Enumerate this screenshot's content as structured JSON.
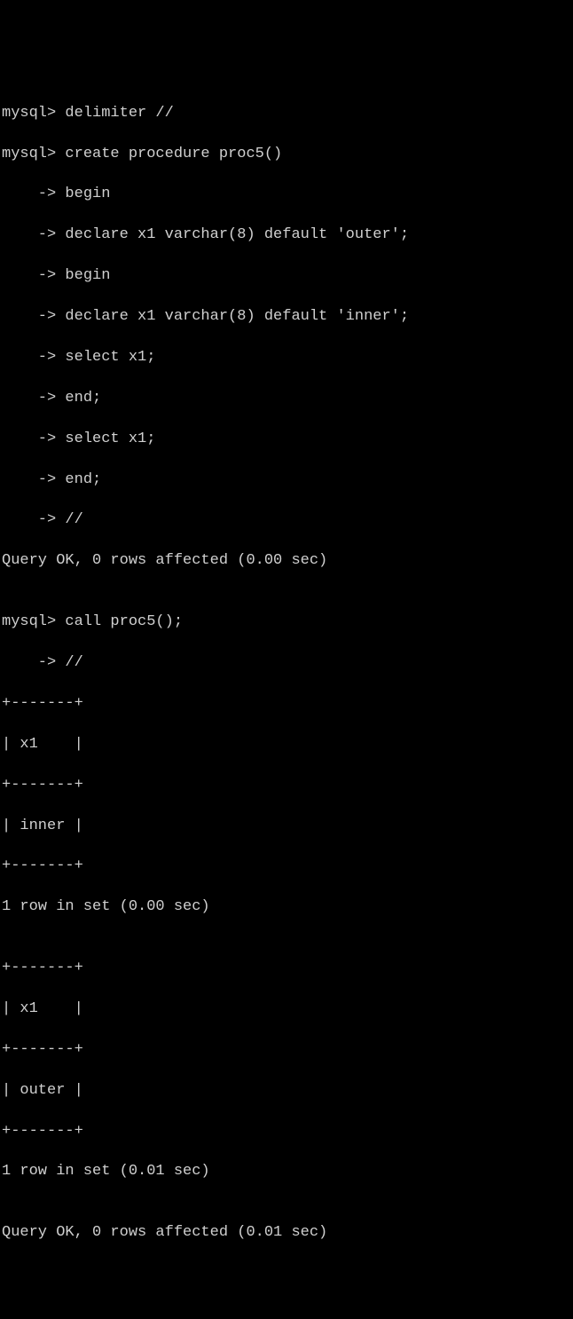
{
  "lines": [
    "mysql> delimiter //",
    "mysql> create procedure proc5()",
    "    -> begin",
    "    -> declare x1 varchar(8) default 'outer';",
    "    -> begin",
    "    -> declare x1 varchar(8) default 'inner';",
    "    -> select x1;",
    "    -> end;",
    "    -> select x1;",
    "    -> end;",
    "    -> //",
    "Query OK, 0 rows affected (0.00 sec)",
    "",
    "mysql> call proc5();",
    "    -> //",
    "+-------+",
    "| x1    |",
    "+-------+",
    "| inner |",
    "+-------+",
    "1 row in set (0.00 sec)",
    "",
    "+-------+",
    "| x1    |",
    "+-------+",
    "| outer |",
    "+-------+",
    "1 row in set (0.01 sec)",
    "",
    "Query OK, 0 rows affected (0.01 sec)"
  ]
}
